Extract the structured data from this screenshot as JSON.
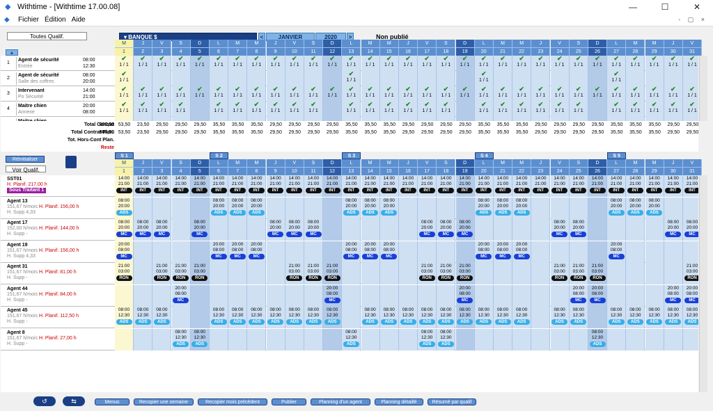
{
  "window": {
    "title": "Withtime - [Withtime 17.00.08]",
    "minimize": "—",
    "maximize": "☐",
    "close": "✕"
  },
  "menu": {
    "items": [
      "Fichier",
      "Édition",
      "Aide"
    ],
    "right": "- ▢ ×"
  },
  "filters": {
    "qualif_button": "Toutes Qualif.",
    "add_button": "+",
    "reset_button": "Réinitialiser",
    "view_qualif_button": "Voir Qualif."
  },
  "header": {
    "banque": "▾ BANQUE $",
    "prev": "<",
    "month": "JANVIER",
    "year": "2020",
    "next": ">",
    "status": "Non publié"
  },
  "days": [
    {
      "l": "M",
      "n": "1",
      "t": 1
    },
    {
      "l": "J",
      "n": "2"
    },
    {
      "l": "V",
      "n": "3"
    },
    {
      "l": "S",
      "n": "4"
    },
    {
      "l": "D",
      "n": "5",
      "w": 1
    },
    {
      "l": "L",
      "n": "6"
    },
    {
      "l": "M",
      "n": "7"
    },
    {
      "l": "M",
      "n": "8"
    },
    {
      "l": "J",
      "n": "9"
    },
    {
      "l": "V",
      "n": "10"
    },
    {
      "l": "S",
      "n": "11"
    },
    {
      "l": "D",
      "n": "12",
      "w": 1
    },
    {
      "l": "L",
      "n": "13"
    },
    {
      "l": "M",
      "n": "14"
    },
    {
      "l": "M",
      "n": "15"
    },
    {
      "l": "J",
      "n": "16"
    },
    {
      "l": "V",
      "n": "17"
    },
    {
      "l": "S",
      "n": "18"
    },
    {
      "l": "D",
      "n": "19",
      "w": 1
    },
    {
      "l": "L",
      "n": "20"
    },
    {
      "l": "M",
      "n": "21"
    },
    {
      "l": "M",
      "n": "22"
    },
    {
      "l": "J",
      "n": "23"
    },
    {
      "l": "V",
      "n": "24"
    },
    {
      "l": "S",
      "n": "25"
    },
    {
      "l": "D",
      "n": "26",
      "w": 1
    },
    {
      "l": "L",
      "n": "27"
    },
    {
      "l": "M",
      "n": "28"
    },
    {
      "l": "M",
      "n": "29"
    },
    {
      "l": "J",
      "n": "30"
    },
    {
      "l": "V",
      "n": "31"
    }
  ],
  "weeks": [
    "S 1",
    "S 2",
    "S 3",
    "S 4",
    "S 5"
  ],
  "qualifications": [
    {
      "num": "1",
      "title": "Agent de sécurité",
      "site": "Entrée",
      "start": "08:00",
      "end": "12:30",
      "count": "1 / 1",
      "days": [
        1,
        2,
        3,
        4,
        5,
        6,
        7,
        8,
        9,
        10,
        11,
        12,
        13,
        14,
        15,
        16,
        17,
        18,
        19,
        20,
        21,
        22,
        23,
        24,
        25,
        26,
        27,
        28,
        29,
        30,
        31
      ]
    },
    {
      "num": "2",
      "title": "Agent de sécurité",
      "site": "Salle des coffres",
      "start": "08:00",
      "end": "20:00",
      "count": "1 / 1",
      "days": [
        1,
        13,
        20,
        27
      ]
    },
    {
      "num": "3",
      "title": "Intervenant",
      "site": "Po Sécurité",
      "start": "14:00",
      "end": "21:00",
      "count": "1 / 1",
      "days": [
        1,
        2,
        3,
        4,
        5,
        6,
        7,
        8,
        9,
        10,
        11,
        12,
        13,
        14,
        15,
        16,
        17,
        18,
        19,
        20,
        21,
        22,
        23,
        24,
        25,
        26,
        27,
        28,
        29,
        30,
        31
      ]
    },
    {
      "num": "4",
      "title": "Maitre chien",
      "site": "Annexe",
      "start": "20:00",
      "end": "08:00",
      "count": "1 / 1",
      "days": [
        1,
        2,
        3,
        4,
        6,
        7,
        8,
        9,
        10,
        11,
        13,
        14,
        15,
        16,
        17,
        18,
        20,
        21,
        22,
        23,
        24,
        25,
        27,
        28,
        29,
        30,
        31
      ]
    },
    {
      "num": "",
      "title": "Maitre chien",
      "site": "",
      "start": "",
      "end": "",
      "count": "",
      "days": []
    }
  ],
  "totals": [
    {
      "label": "Total Contrat",
      "sum": "980,50",
      "values": [
        "53,50",
        "23,50",
        "29,50",
        "29,50",
        "29,50",
        "35,50",
        "35,50",
        "35,50",
        "29,50",
        "29,50",
        "29,50",
        "29,50",
        "35,50",
        "35,50",
        "35,50",
        "29,50",
        "29,50",
        "29,50",
        "29,50",
        "35,50",
        "35,50",
        "35,50",
        "29,50",
        "29,50",
        "29,50",
        "29,50",
        "35,50",
        "35,50",
        "35,50",
        "29,50",
        "29,50"
      ]
    },
    {
      "label": "Total Contrat Plan.",
      "sum": "980,50",
      "values": [
        "53,50",
        "23,50",
        "29,50",
        "29,50",
        "29,50",
        "35,50",
        "35,50",
        "35,50",
        "29,50",
        "29,50",
        "29,50",
        "29,50",
        "35,50",
        "35,50",
        "35,50",
        "29,50",
        "29,50",
        "29,50",
        "29,50",
        "35,50",
        "35,50",
        "35,50",
        "29,50",
        "29,50",
        "29,50",
        "29,50",
        "35,50",
        "35,50",
        "35,50",
        "29,50",
        "29,50"
      ]
    },
    {
      "label": "Tot. Hors-Cont Plan.",
      "sum": "",
      "values": []
    },
    {
      "label": "Reste",
      "sum": "",
      "values": [],
      "red": true
    }
  ],
  "agents": [
    {
      "name": "SST01",
      "line1": "H. Planif. 217,00 h",
      "line2": "Sous Traitant 1",
      "kind": "sst",
      "cells": {
        "1": [
          "14:00",
          "21:00",
          "INT"
        ],
        "2": [
          "14:00",
          "21:00",
          "INT"
        ],
        "3": [
          "14:00",
          "21:00",
          "INT"
        ],
        "4": [
          "14:00",
          "21:00",
          "INT"
        ],
        "5": [
          "14:00",
          "21:00",
          "INT"
        ],
        "6": [
          "14:00",
          "21:00",
          "INT"
        ],
        "7": [
          "14:00",
          "21:00",
          "INT"
        ],
        "8": [
          "14:00",
          "21:00",
          "INT"
        ],
        "9": [
          "14:00",
          "21:00",
          "INT"
        ],
        "10": [
          "14:00",
          "21:00",
          "INT"
        ],
        "11": [
          "14:00",
          "21:00",
          "INT"
        ],
        "12": [
          "14:00",
          "21:00",
          "INT"
        ],
        "13": [
          "14:00",
          "21:00",
          "INT"
        ],
        "14": [
          "14:00",
          "21:00",
          "INT"
        ],
        "15": [
          "14:00",
          "21:00",
          "INT"
        ],
        "16": [
          "14:00",
          "21:00",
          "INT"
        ],
        "17": [
          "14:00",
          "21:00",
          "INT"
        ],
        "18": [
          "14:00",
          "21:00",
          "INT"
        ],
        "19": [
          "14:00",
          "21:00",
          "INT"
        ],
        "20": [
          "14:00",
          "21:00",
          "INT"
        ],
        "21": [
          "14:00",
          "21:00",
          "INT"
        ],
        "22": [
          "14:00",
          "21:00",
          "INT"
        ],
        "23": [
          "14:00",
          "21:00",
          "INT"
        ],
        "24": [
          "14:00",
          "21:00",
          "INT"
        ],
        "25": [
          "14:00",
          "21:00",
          "INT"
        ],
        "26": [
          "14:00",
          "21:00",
          "INT"
        ],
        "27": [
          "14:00",
          "21:00",
          "INT"
        ],
        "28": [
          "14:00",
          "21:00",
          "INT"
        ],
        "29": [
          "14:00",
          "21:00",
          "INT"
        ],
        "30": [
          "14:00",
          "21:00",
          "INT"
        ],
        "31": [
          "14:00",
          "21:00",
          "INT"
        ]
      }
    },
    {
      "name": "Agent 13",
      "line1": "151,67 h/mois",
      "planif": "H. Planif. 156,00 h",
      "line2": "H. Supp",
      "supp": "4,33",
      "cells": {
        "1": [
          "08:00",
          "20:00",
          "ADS"
        ],
        "6": [
          "08:00",
          "20:00",
          "ADS"
        ],
        "7": [
          "08:00",
          "20:00",
          "ADS"
        ],
        "8": [
          "08:00",
          "20:00",
          "ADS"
        ],
        "13": [
          "08:00",
          "20:00",
          "ADS"
        ],
        "14": [
          "08:00",
          "20:00",
          "ADS"
        ],
        "15": [
          "08:00",
          "20:00",
          "ADS"
        ],
        "20": [
          "08:00",
          "20:00",
          "ADS"
        ],
        "21": [
          "08:00",
          "20:00",
          "ADS"
        ],
        "22": [
          "08:00",
          "20:00",
          "ADS"
        ],
        "27": [
          "08:00",
          "20:00",
          "ADS"
        ],
        "28": [
          "08:00",
          "20:00",
          "ADS"
        ],
        "29": [
          "08:00",
          "20:00",
          "ADS"
        ]
      }
    },
    {
      "name": "Agent 17",
      "line1": "152,00 h/mois",
      "planif": "H. Planif. 144,00 h",
      "line2": "H. Supp",
      "supp": "-",
      "cells": {
        "1": [
          "08:00",
          "20:00",
          "MC"
        ],
        "2": [
          "08:00",
          "20:00",
          "MC"
        ],
        "3": [
          "08:00",
          "20:00",
          "MC"
        ],
        "5": [
          "08:00",
          "20:00",
          "MC"
        ],
        "9": [
          "08:00",
          "20:00",
          "MC"
        ],
        "10": [
          "08:00",
          "20:00",
          "MC"
        ],
        "11": [
          "08:00",
          "20:00",
          "MC"
        ],
        "17": [
          "08:00",
          "20:00",
          "MC"
        ],
        "18": [
          "08:00",
          "20:00",
          "MC"
        ],
        "19": [
          "08:00",
          "20:00",
          "MC"
        ],
        "24": [
          "08:00",
          "20:00",
          "MC"
        ],
        "25": [
          "08:00",
          "20:00",
          "MC"
        ],
        "30": [
          "08:00",
          "20:00",
          "MC"
        ],
        "31": [
          "08:00",
          "20:00",
          "MC"
        ]
      }
    },
    {
      "name": "Agent 19",
      "line1": "151,67 h/mois",
      "planif": "H. Planif. 156,00 h",
      "line2": "H. Supp",
      "supp": "4,33",
      "cells": {
        "1": [
          "20:00",
          "08:00",
          "MC"
        ],
        "6": [
          "20:00",
          "08:00",
          "MC"
        ],
        "7": [
          "20:00",
          "08:00",
          "MC"
        ],
        "8": [
          "20:00",
          "08:00",
          "MC"
        ],
        "13": [
          "20:00",
          "08:00",
          "MC"
        ],
        "14": [
          "20:00",
          "08:00",
          "MC"
        ],
        "15": [
          "20:00",
          "08:00",
          "MC"
        ],
        "20": [
          "20:00",
          "08:00",
          "MC"
        ],
        "21": [
          "20:00",
          "08:00",
          "MC"
        ],
        "22": [
          "20:00",
          "08:00",
          "MC"
        ],
        "27": [
          "20:00",
          "08:00",
          "MC"
        ]
      }
    },
    {
      "name": "Agent 31",
      "line1": "151,67 h/mois",
      "planif": "H. Planif.   81,00 h",
      "line2": "H. Supp",
      "supp": "-",
      "cells": {
        "1": [
          "21:00",
          "03:00",
          "RON"
        ],
        "3": [
          "21:00",
          "03:00",
          "RON"
        ],
        "4": [
          "21:00",
          "03:00",
          "RON"
        ],
        "5": [
          "21:00",
          "03:00",
          "RON"
        ],
        "10": [
          "21:00",
          "03:00",
          "RON"
        ],
        "11": [
          "21:00",
          "03:00",
          "RON"
        ],
        "12": [
          "21:00",
          "03:00",
          "RON"
        ],
        "17": [
          "21:00",
          "03:00",
          "RON"
        ],
        "18": [
          "21:00",
          "03:00",
          "RON"
        ],
        "19": [
          "21:00",
          "03:00",
          "RON"
        ],
        "24": [
          "21:00",
          "03:00",
          "RON"
        ],
        "25": [
          "21:00",
          "03:00",
          "RON"
        ],
        "26": [
          "21:00",
          "03:00",
          "RON"
        ],
        "31": [
          "21:00",
          "03:00",
          "RON"
        ]
      }
    },
    {
      "name": "Agent 44",
      "line1": "151,67 h/mois",
      "planif": "H. Planif.   84,00 h",
      "line2": "H. Supp",
      "supp": "-",
      "cells": {
        "4": [
          "20:00",
          "08:00",
          "MC"
        ],
        "12": [
          "20:00",
          "08:00",
          "MC"
        ],
        "19": [
          "20:00",
          "08:00",
          "MC"
        ],
        "25": [
          "20:00",
          "08:00",
          "MC"
        ],
        "26": [
          "20:00",
          "08:00",
          "MC"
        ],
        "30": [
          "20:00",
          "08:00",
          "MC"
        ],
        "31": [
          "20:00",
          "08:00",
          "MC"
        ]
      }
    },
    {
      "name": "Agent 45",
      "line1": "151,67 h/mois",
      "planif": "H. Planif. 112,50 h",
      "line2": "H. Supp",
      "supp": "-",
      "cells": {
        "1": [
          "08:00",
          "12:30",
          "ADS"
        ],
        "2": [
          "08:00",
          "12:30",
          "ADS"
        ],
        "3": [
          "08:00",
          "12:30",
          "ADS"
        ],
        "6": [
          "08:00",
          "12:30",
          "ADS"
        ],
        "7": [
          "08:00",
          "12:30",
          "ADS"
        ],
        "8": [
          "08:00",
          "12:30",
          "ADS"
        ],
        "9": [
          "08:00",
          "12:30",
          "ADS"
        ],
        "10": [
          "08:00",
          "12:30",
          "ADS"
        ],
        "11": [
          "08:00",
          "12:30",
          "ADS"
        ],
        "12": [
          "08:00",
          "12:30",
          "ADS"
        ],
        "14": [
          "08:00",
          "12:30",
          "ADS"
        ],
        "15": [
          "08:00",
          "12:30",
          "ADS"
        ],
        "16": [
          "08:00",
          "12:30",
          "ADS"
        ],
        "17": [
          "08:00",
          "12:30",
          "ADS"
        ],
        "18": [
          "08:00",
          "12:30",
          "ADS"
        ],
        "19": [
          "08:00",
          "12:30",
          "ADS"
        ],
        "20": [
          "08:00",
          "12:30",
          "ADS"
        ],
        "21": [
          "08:00",
          "12:30",
          "ADS"
        ],
        "22": [
          "08:00",
          "12:30",
          "ADS"
        ],
        "24": [
          "08:00",
          "12:30",
          "ADS"
        ],
        "25": [
          "08:00",
          "12:30",
          "ADS"
        ],
        "27": [
          "08:00",
          "12:30",
          "ADS"
        ],
        "28": [
          "08:00",
          "12:30",
          "ADS"
        ],
        "29": [
          "08:00",
          "12:30",
          "ADS"
        ],
        "30": [
          "08:00",
          "12:30",
          "ADS"
        ],
        "31": [
          "08:00",
          "12:30",
          "ADS"
        ]
      }
    },
    {
      "name": "Agent 8",
      "line1": "151,67 h/mois",
      "planif": "H. Planif.   27,00 h",
      "line2": "H. Supp",
      "supp": "-",
      "cells": {
        "4": [
          "08:00",
          "12:30",
          "ADS"
        ],
        "5": [
          "08:00",
          "12:30",
          "ADS"
        ],
        "13": [
          "08:00",
          "12:30",
          "ADS"
        ],
        "17": [
          "08:00",
          "12:30",
          "ADS"
        ],
        "18": [
          "08:00",
          "12:30",
          "ADS"
        ],
        "26": [
          "08:00",
          "12:30",
          "ADS"
        ]
      }
    }
  ],
  "bottom": {
    "buttons": [
      "Menus",
      "Recopier une semaine",
      "Recopier mois précédent",
      "Publier",
      "Planning d'un agent",
      "Planning détaillé",
      "Résumé par qualif"
    ],
    "round1": "↺",
    "round2": "⇆"
  }
}
